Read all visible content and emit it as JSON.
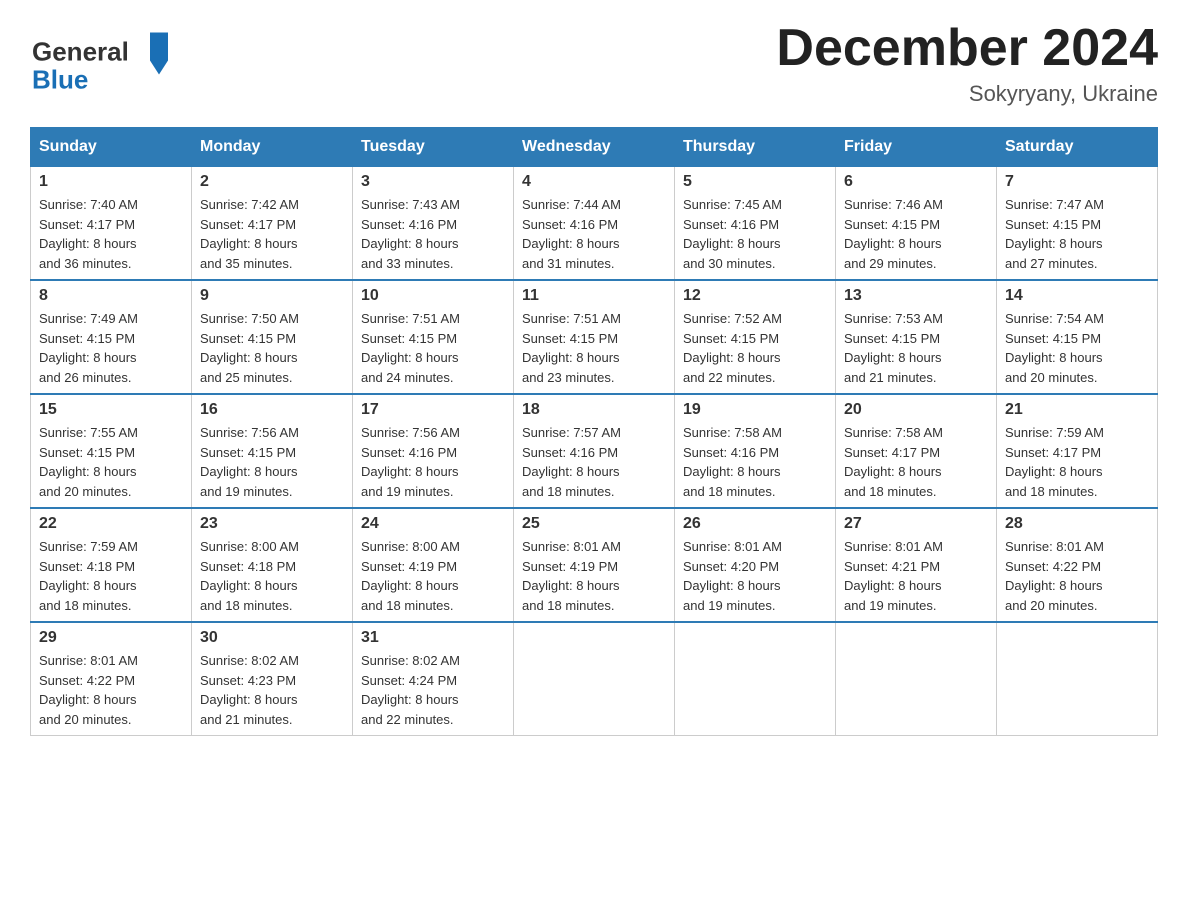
{
  "header": {
    "logo_general": "General",
    "logo_blue": "Blue",
    "month_title": "December 2024",
    "location": "Sokyryany, Ukraine"
  },
  "weekdays": [
    "Sunday",
    "Monday",
    "Tuesday",
    "Wednesday",
    "Thursday",
    "Friday",
    "Saturday"
  ],
  "weeks": [
    [
      {
        "day": "1",
        "sunrise": "7:40 AM",
        "sunset": "4:17 PM",
        "daylight": "8 hours and 36 minutes."
      },
      {
        "day": "2",
        "sunrise": "7:42 AM",
        "sunset": "4:17 PM",
        "daylight": "8 hours and 35 minutes."
      },
      {
        "day": "3",
        "sunrise": "7:43 AM",
        "sunset": "4:16 PM",
        "daylight": "8 hours and 33 minutes."
      },
      {
        "day": "4",
        "sunrise": "7:44 AM",
        "sunset": "4:16 PM",
        "daylight": "8 hours and 31 minutes."
      },
      {
        "day": "5",
        "sunrise": "7:45 AM",
        "sunset": "4:16 PM",
        "daylight": "8 hours and 30 minutes."
      },
      {
        "day": "6",
        "sunrise": "7:46 AM",
        "sunset": "4:15 PM",
        "daylight": "8 hours and 29 minutes."
      },
      {
        "day": "7",
        "sunrise": "7:47 AM",
        "sunset": "4:15 PM",
        "daylight": "8 hours and 27 minutes."
      }
    ],
    [
      {
        "day": "8",
        "sunrise": "7:49 AM",
        "sunset": "4:15 PM",
        "daylight": "8 hours and 26 minutes."
      },
      {
        "day": "9",
        "sunrise": "7:50 AM",
        "sunset": "4:15 PM",
        "daylight": "8 hours and 25 minutes."
      },
      {
        "day": "10",
        "sunrise": "7:51 AM",
        "sunset": "4:15 PM",
        "daylight": "8 hours and 24 minutes."
      },
      {
        "day": "11",
        "sunrise": "7:51 AM",
        "sunset": "4:15 PM",
        "daylight": "8 hours and 23 minutes."
      },
      {
        "day": "12",
        "sunrise": "7:52 AM",
        "sunset": "4:15 PM",
        "daylight": "8 hours and 22 minutes."
      },
      {
        "day": "13",
        "sunrise": "7:53 AM",
        "sunset": "4:15 PM",
        "daylight": "8 hours and 21 minutes."
      },
      {
        "day": "14",
        "sunrise": "7:54 AM",
        "sunset": "4:15 PM",
        "daylight": "8 hours and 20 minutes."
      }
    ],
    [
      {
        "day": "15",
        "sunrise": "7:55 AM",
        "sunset": "4:15 PM",
        "daylight": "8 hours and 20 minutes."
      },
      {
        "day": "16",
        "sunrise": "7:56 AM",
        "sunset": "4:15 PM",
        "daylight": "8 hours and 19 minutes."
      },
      {
        "day": "17",
        "sunrise": "7:56 AM",
        "sunset": "4:16 PM",
        "daylight": "8 hours and 19 minutes."
      },
      {
        "day": "18",
        "sunrise": "7:57 AM",
        "sunset": "4:16 PM",
        "daylight": "8 hours and 18 minutes."
      },
      {
        "day": "19",
        "sunrise": "7:58 AM",
        "sunset": "4:16 PM",
        "daylight": "8 hours and 18 minutes."
      },
      {
        "day": "20",
        "sunrise": "7:58 AM",
        "sunset": "4:17 PM",
        "daylight": "8 hours and 18 minutes."
      },
      {
        "day": "21",
        "sunrise": "7:59 AM",
        "sunset": "4:17 PM",
        "daylight": "8 hours and 18 minutes."
      }
    ],
    [
      {
        "day": "22",
        "sunrise": "7:59 AM",
        "sunset": "4:18 PM",
        "daylight": "8 hours and 18 minutes."
      },
      {
        "day": "23",
        "sunrise": "8:00 AM",
        "sunset": "4:18 PM",
        "daylight": "8 hours and 18 minutes."
      },
      {
        "day": "24",
        "sunrise": "8:00 AM",
        "sunset": "4:19 PM",
        "daylight": "8 hours and 18 minutes."
      },
      {
        "day": "25",
        "sunrise": "8:01 AM",
        "sunset": "4:19 PM",
        "daylight": "8 hours and 18 minutes."
      },
      {
        "day": "26",
        "sunrise": "8:01 AM",
        "sunset": "4:20 PM",
        "daylight": "8 hours and 19 minutes."
      },
      {
        "day": "27",
        "sunrise": "8:01 AM",
        "sunset": "4:21 PM",
        "daylight": "8 hours and 19 minutes."
      },
      {
        "day": "28",
        "sunrise": "8:01 AM",
        "sunset": "4:22 PM",
        "daylight": "8 hours and 20 minutes."
      }
    ],
    [
      {
        "day": "29",
        "sunrise": "8:01 AM",
        "sunset": "4:22 PM",
        "daylight": "8 hours and 20 minutes."
      },
      {
        "day": "30",
        "sunrise": "8:02 AM",
        "sunset": "4:23 PM",
        "daylight": "8 hours and 21 minutes."
      },
      {
        "day": "31",
        "sunrise": "8:02 AM",
        "sunset": "4:24 PM",
        "daylight": "8 hours and 22 minutes."
      },
      null,
      null,
      null,
      null
    ]
  ],
  "labels": {
    "sunrise": "Sunrise:",
    "sunset": "Sunset:",
    "daylight": "Daylight:"
  }
}
